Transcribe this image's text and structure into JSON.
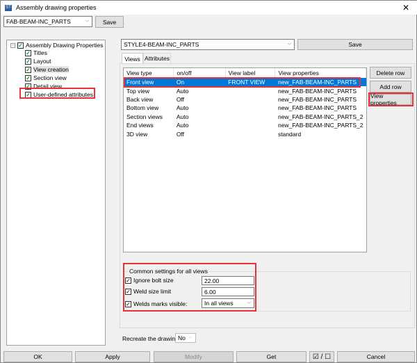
{
  "window": {
    "title": "Assembly drawing properties",
    "close": "✕"
  },
  "top": {
    "preset": "FAB-BEAM-INC_PARTS",
    "save": "Save"
  },
  "tree": {
    "root": "Assembly Drawing Properties",
    "items": [
      "Titles",
      "Layout",
      "View creation",
      "Section view",
      "Detail view",
      "User-defined attributes"
    ]
  },
  "right": {
    "preset": "STYLE4-BEAM-INC_PARTS",
    "save": "Save"
  },
  "tabs": [
    "Views",
    "Attributes"
  ],
  "table": {
    "headers": [
      "View type",
      "on/off",
      "View label",
      "View properties"
    ],
    "rows": [
      [
        "Front view",
        "On",
        "FRONT VIEW",
        "new_FAB-BEAM-INC_PARTS"
      ],
      [
        "Top view",
        "Auto",
        "",
        "new_FAB-BEAM-INC_PARTS"
      ],
      [
        "Back view",
        "Off",
        "",
        "new_FAB-BEAM-INC_PARTS"
      ],
      [
        "Bottom view",
        "Auto",
        "",
        "new_FAB-BEAM-INC_PARTS"
      ],
      [
        "Section views",
        "Auto",
        "",
        "new_FAB-BEAM-INC_PARTS_2"
      ],
      [
        "End views",
        "Auto",
        "",
        "new_FAB-BEAM-INC_PARTS_2"
      ],
      [
        "3D view",
        "Off",
        "",
        "standard"
      ]
    ]
  },
  "side_buttons": {
    "delete": "Delete row",
    "add": "Add row",
    "view_props": "View properties"
  },
  "common": {
    "title": "Common settings for all views",
    "ignore_bolt": "Ignore bolt size",
    "ignore_bolt_value": "22.00",
    "weld_limit": "Weld size limit",
    "weld_limit_value": "6.00",
    "weld_marks": "Welds marks visible:",
    "weld_marks_value": "In all views"
  },
  "recreate": {
    "label": "Recreate the drawing",
    "value": "No"
  },
  "bottom": {
    "ok": "OK",
    "apply": "Apply",
    "modify": "Modify",
    "get": "Get",
    "toggle": "☑ / ☐",
    "cancel": "Cancel"
  }
}
